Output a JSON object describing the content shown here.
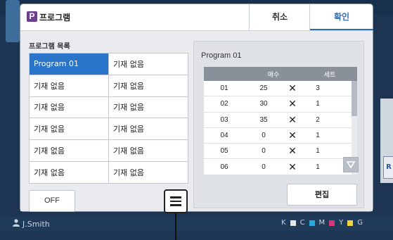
{
  "dialog": {
    "title": "프로그램",
    "icon_letter": "P",
    "cancel_label": "취소",
    "ok_label": "확인"
  },
  "program_list": {
    "title": "프로그램 목록",
    "items": [
      {
        "label": "Program 01",
        "selected": true
      },
      {
        "label": "기재 없음",
        "selected": false
      },
      {
        "label": "기재 없음",
        "selected": false
      },
      {
        "label": "기재 없음",
        "selected": false
      },
      {
        "label": "기재 없음",
        "selected": false
      },
      {
        "label": "기재 없음",
        "selected": false
      },
      {
        "label": "기재 없음",
        "selected": false
      },
      {
        "label": "기재 없음",
        "selected": false
      },
      {
        "label": "기재 없음",
        "selected": false
      },
      {
        "label": "기재 없음",
        "selected": false
      },
      {
        "label": "기재 없음",
        "selected": false
      },
      {
        "label": "기재 없음",
        "selected": false
      }
    ],
    "off_label": "OFF"
  },
  "detail": {
    "program_name": "Program 01",
    "col_count": "매수",
    "col_sets": "세트",
    "rows": [
      {
        "no": "01",
        "count": "25",
        "sets": "3"
      },
      {
        "no": "02",
        "count": "30",
        "sets": "1"
      },
      {
        "no": "03",
        "count": "35",
        "sets": "2"
      },
      {
        "no": "04",
        "count": "0",
        "sets": "1"
      },
      {
        "no": "05",
        "count": "0",
        "sets": "1"
      },
      {
        "no": "06",
        "count": "0",
        "sets": "1"
      }
    ],
    "times_symbol": "✕",
    "edit_label": "편집"
  },
  "status_bar": {
    "user": "J.Smith",
    "ink_labels": [
      "K",
      "C",
      "M",
      "Y",
      "G"
    ]
  },
  "colors": {
    "accent": "#2a75c9",
    "program_icon": "#6a3f8f"
  }
}
